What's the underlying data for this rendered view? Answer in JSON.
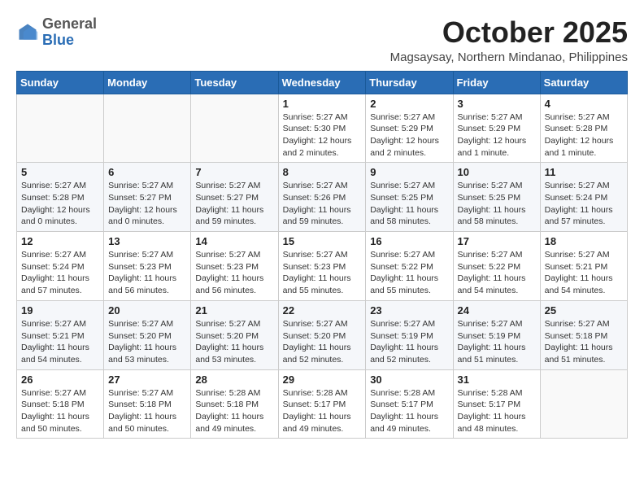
{
  "logo": {
    "general": "General",
    "blue": "Blue"
  },
  "header": {
    "month": "October 2025",
    "subtitle": "Magsaysay, Northern Mindanao, Philippines"
  },
  "days_of_week": [
    "Sunday",
    "Monday",
    "Tuesday",
    "Wednesday",
    "Thursday",
    "Friday",
    "Saturday"
  ],
  "weeks": [
    [
      {
        "day": "",
        "info": ""
      },
      {
        "day": "",
        "info": ""
      },
      {
        "day": "",
        "info": ""
      },
      {
        "day": "1",
        "info": "Sunrise: 5:27 AM\nSunset: 5:30 PM\nDaylight: 12 hours\nand 2 minutes."
      },
      {
        "day": "2",
        "info": "Sunrise: 5:27 AM\nSunset: 5:29 PM\nDaylight: 12 hours\nand 2 minutes."
      },
      {
        "day": "3",
        "info": "Sunrise: 5:27 AM\nSunset: 5:29 PM\nDaylight: 12 hours\nand 1 minute."
      },
      {
        "day": "4",
        "info": "Sunrise: 5:27 AM\nSunset: 5:28 PM\nDaylight: 12 hours\nand 1 minute."
      }
    ],
    [
      {
        "day": "5",
        "info": "Sunrise: 5:27 AM\nSunset: 5:28 PM\nDaylight: 12 hours\nand 0 minutes."
      },
      {
        "day": "6",
        "info": "Sunrise: 5:27 AM\nSunset: 5:27 PM\nDaylight: 12 hours\nand 0 minutes."
      },
      {
        "day": "7",
        "info": "Sunrise: 5:27 AM\nSunset: 5:27 PM\nDaylight: 11 hours\nand 59 minutes."
      },
      {
        "day": "8",
        "info": "Sunrise: 5:27 AM\nSunset: 5:26 PM\nDaylight: 11 hours\nand 59 minutes."
      },
      {
        "day": "9",
        "info": "Sunrise: 5:27 AM\nSunset: 5:25 PM\nDaylight: 11 hours\nand 58 minutes."
      },
      {
        "day": "10",
        "info": "Sunrise: 5:27 AM\nSunset: 5:25 PM\nDaylight: 11 hours\nand 58 minutes."
      },
      {
        "day": "11",
        "info": "Sunrise: 5:27 AM\nSunset: 5:24 PM\nDaylight: 11 hours\nand 57 minutes."
      }
    ],
    [
      {
        "day": "12",
        "info": "Sunrise: 5:27 AM\nSunset: 5:24 PM\nDaylight: 11 hours\nand 57 minutes."
      },
      {
        "day": "13",
        "info": "Sunrise: 5:27 AM\nSunset: 5:23 PM\nDaylight: 11 hours\nand 56 minutes."
      },
      {
        "day": "14",
        "info": "Sunrise: 5:27 AM\nSunset: 5:23 PM\nDaylight: 11 hours\nand 56 minutes."
      },
      {
        "day": "15",
        "info": "Sunrise: 5:27 AM\nSunset: 5:23 PM\nDaylight: 11 hours\nand 55 minutes."
      },
      {
        "day": "16",
        "info": "Sunrise: 5:27 AM\nSunset: 5:22 PM\nDaylight: 11 hours\nand 55 minutes."
      },
      {
        "day": "17",
        "info": "Sunrise: 5:27 AM\nSunset: 5:22 PM\nDaylight: 11 hours\nand 54 minutes."
      },
      {
        "day": "18",
        "info": "Sunrise: 5:27 AM\nSunset: 5:21 PM\nDaylight: 11 hours\nand 54 minutes."
      }
    ],
    [
      {
        "day": "19",
        "info": "Sunrise: 5:27 AM\nSunset: 5:21 PM\nDaylight: 11 hours\nand 54 minutes."
      },
      {
        "day": "20",
        "info": "Sunrise: 5:27 AM\nSunset: 5:20 PM\nDaylight: 11 hours\nand 53 minutes."
      },
      {
        "day": "21",
        "info": "Sunrise: 5:27 AM\nSunset: 5:20 PM\nDaylight: 11 hours\nand 53 minutes."
      },
      {
        "day": "22",
        "info": "Sunrise: 5:27 AM\nSunset: 5:20 PM\nDaylight: 11 hours\nand 52 minutes."
      },
      {
        "day": "23",
        "info": "Sunrise: 5:27 AM\nSunset: 5:19 PM\nDaylight: 11 hours\nand 52 minutes."
      },
      {
        "day": "24",
        "info": "Sunrise: 5:27 AM\nSunset: 5:19 PM\nDaylight: 11 hours\nand 51 minutes."
      },
      {
        "day": "25",
        "info": "Sunrise: 5:27 AM\nSunset: 5:18 PM\nDaylight: 11 hours\nand 51 minutes."
      }
    ],
    [
      {
        "day": "26",
        "info": "Sunrise: 5:27 AM\nSunset: 5:18 PM\nDaylight: 11 hours\nand 50 minutes."
      },
      {
        "day": "27",
        "info": "Sunrise: 5:27 AM\nSunset: 5:18 PM\nDaylight: 11 hours\nand 50 minutes."
      },
      {
        "day": "28",
        "info": "Sunrise: 5:28 AM\nSunset: 5:18 PM\nDaylight: 11 hours\nand 49 minutes."
      },
      {
        "day": "29",
        "info": "Sunrise: 5:28 AM\nSunset: 5:17 PM\nDaylight: 11 hours\nand 49 minutes."
      },
      {
        "day": "30",
        "info": "Sunrise: 5:28 AM\nSunset: 5:17 PM\nDaylight: 11 hours\nand 49 minutes."
      },
      {
        "day": "31",
        "info": "Sunrise: 5:28 AM\nSunset: 5:17 PM\nDaylight: 11 hours\nand 48 minutes."
      },
      {
        "day": "",
        "info": ""
      }
    ]
  ]
}
